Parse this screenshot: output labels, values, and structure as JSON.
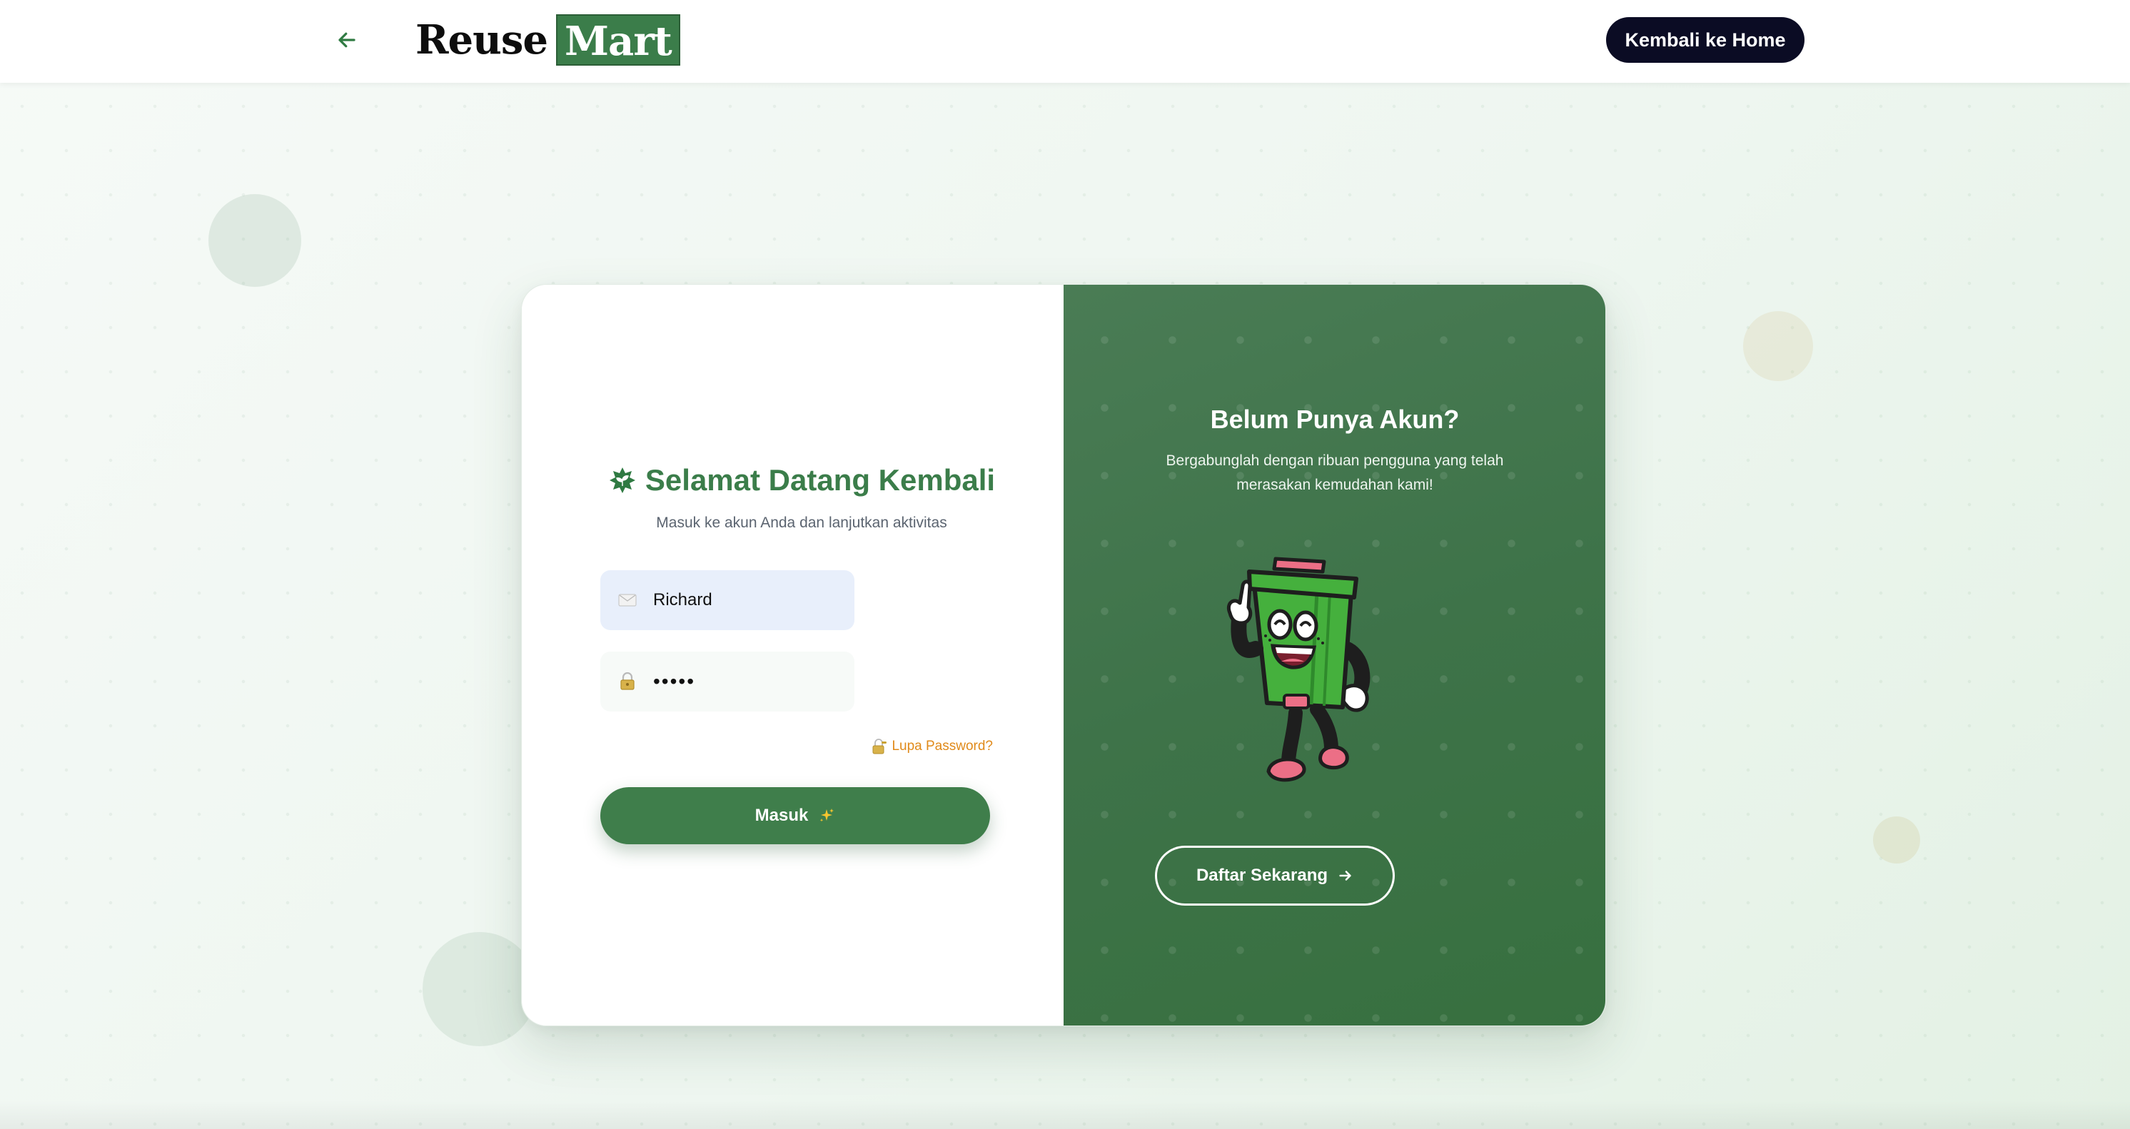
{
  "navbar": {
    "back_icon": "arrow-left-icon",
    "logo_part1": "Reuse",
    "logo_part2": "Mart",
    "home_button": "Kembali ke Home"
  },
  "login": {
    "title_icon": "seedling-badge-icon",
    "title": "Selamat Datang Kembali",
    "subtitle": "Masuk ke akun Anda dan lanjutkan aktivitas",
    "email": {
      "icon": "mail-icon",
      "value": "Richard"
    },
    "password": {
      "icon": "lock-icon",
      "value": "•••••"
    },
    "forgot_icon": "lock-key-icon",
    "forgot_label": "Lupa Password?",
    "submit_label": "Masuk",
    "submit_icon": "sparkles-icon"
  },
  "promo": {
    "title": "Belum Punya Akun?",
    "text": "Bergabunglah dengan ribuan pengguna yang telah merasakan kemudahan kami!",
    "mascot": "trash-bin-mascot",
    "register_label": "Daftar Sekarang",
    "register_icon": "arrow-right-icon"
  },
  "colors": {
    "brand_green": "#3b7d4a",
    "dark_button": "#0b0c24",
    "panel_green": "#3e7349",
    "link_orange": "#e08a1a",
    "input_bg": "#e8effb"
  }
}
